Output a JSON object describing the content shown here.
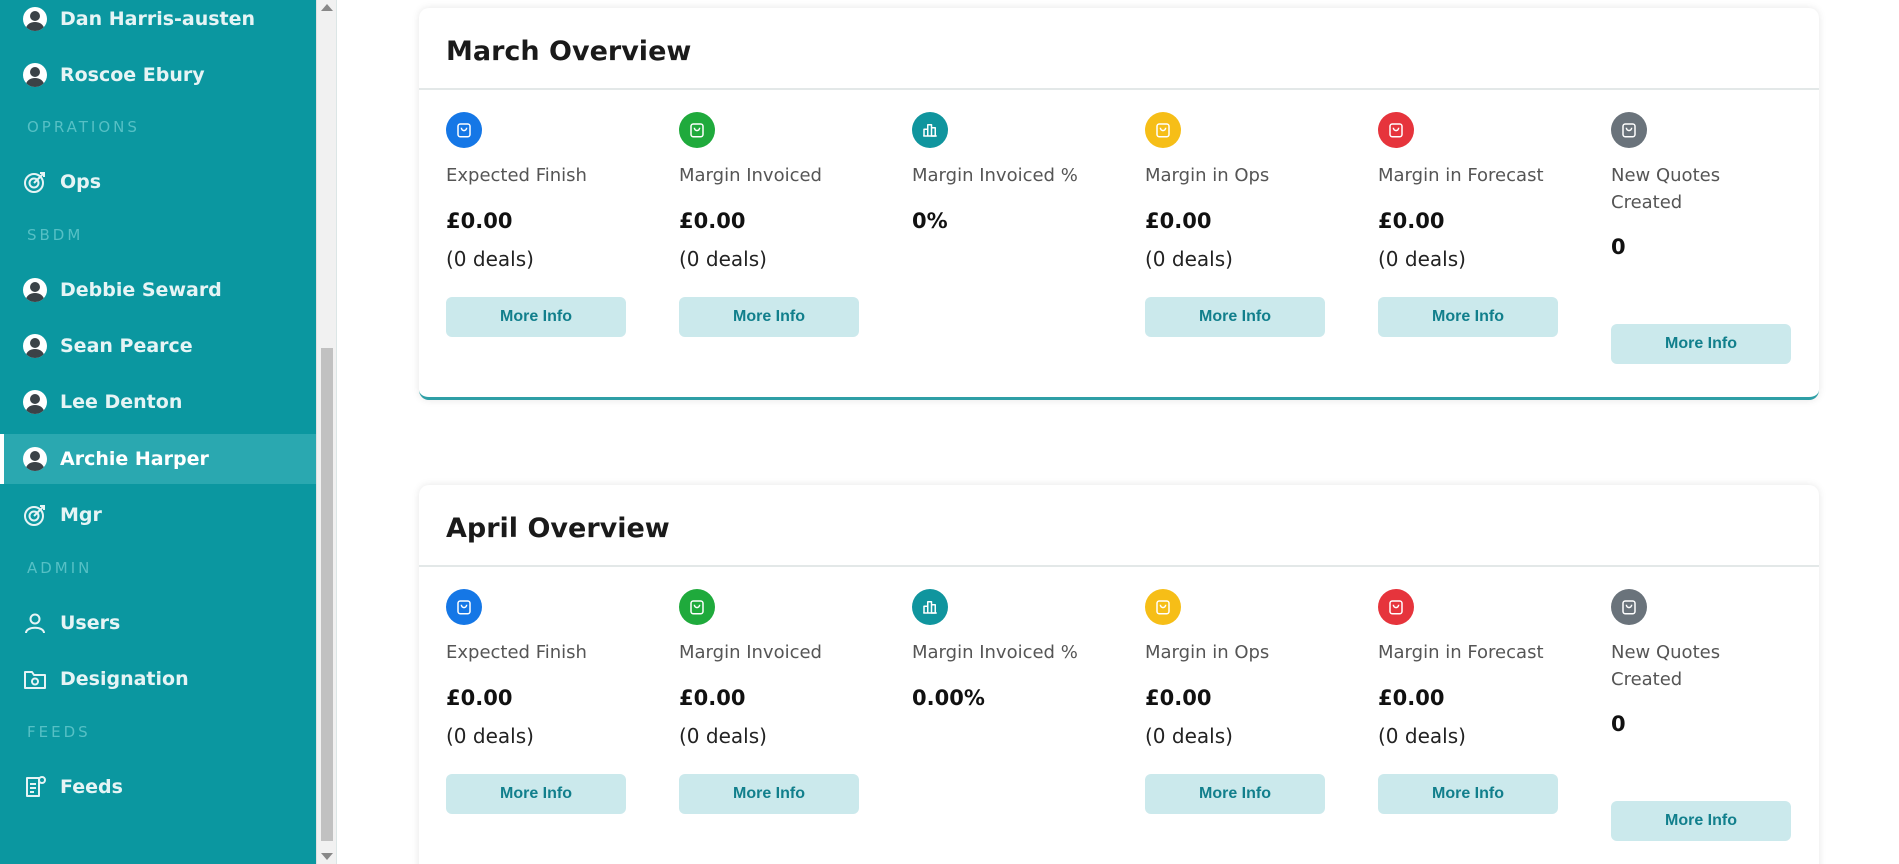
{
  "sidebar": {
    "items": [
      {
        "label": "Dan Harris-austen",
        "icon": "user-avatar-icon"
      },
      {
        "label": "Roscoe Ebury",
        "icon": "user-avatar-icon"
      },
      {
        "section": "OPRATIONS"
      },
      {
        "label": "Ops",
        "icon": "target-icon"
      },
      {
        "section": "SBDM"
      },
      {
        "label": "Debbie Seward",
        "icon": "user-avatar-icon"
      },
      {
        "label": "Sean Pearce",
        "icon": "user-avatar-icon"
      },
      {
        "label": "Lee Denton",
        "icon": "user-avatar-icon"
      },
      {
        "label": "Archie Harper",
        "icon": "user-avatar-icon",
        "active": true
      },
      {
        "label": "Mgr",
        "icon": "target-icon"
      },
      {
        "section": "ADMIN"
      },
      {
        "label": "Users",
        "icon": "user-outline-icon"
      },
      {
        "label": "Designation",
        "icon": "folder-icon"
      },
      {
        "section": "FEEDS"
      },
      {
        "label": "Feeds",
        "icon": "feed-icon"
      }
    ]
  },
  "colors": {
    "sidebar_bg": "#0b97a0",
    "active_item_bg": "#2aa8b0",
    "button_bg": "#cbe9ec",
    "button_text": "#117f8c",
    "blue": "#1577e6",
    "green": "#1faa3c",
    "teal": "#10959e",
    "yellow": "#f6be17",
    "red": "#e6343c",
    "gray": "#6a737b"
  },
  "cards": [
    {
      "title": "March Overview",
      "metrics": [
        {
          "label": "Expected Finish",
          "value": "£0.00",
          "deals": "(0 deals)",
          "button": "More Info",
          "color": "blue",
          "icon": "bag-icon"
        },
        {
          "label": "Margin Invoiced",
          "value": "£0.00",
          "deals": "(0 deals)",
          "button": "More Info",
          "color": "green",
          "icon": "bag-icon"
        },
        {
          "label": "Margin Invoiced %",
          "value": "0%",
          "deals": "",
          "button": "",
          "color": "teal",
          "icon": "bar-chart-icon"
        },
        {
          "label": "Margin in Ops",
          "value": "£0.00",
          "deals": "(0 deals)",
          "button": "More Info",
          "color": "yellow",
          "icon": "bag-icon"
        },
        {
          "label": "Margin in Forecast",
          "value": "£0.00",
          "deals": "(0 deals)",
          "button": "More Info",
          "color": "red",
          "icon": "bag-icon"
        },
        {
          "label": "New Quotes Created",
          "value": "0",
          "deals": "",
          "button": "More Info",
          "color": "gray",
          "icon": "bag-icon"
        }
      ]
    },
    {
      "title": "April Overview",
      "metrics": [
        {
          "label": "Expected Finish",
          "value": "£0.00",
          "deals": "(0 deals)",
          "button": "More Info",
          "color": "blue",
          "icon": "bag-icon"
        },
        {
          "label": "Margin Invoiced",
          "value": "£0.00",
          "deals": "(0 deals)",
          "button": "More Info",
          "color": "green",
          "icon": "bag-icon"
        },
        {
          "label": "Margin Invoiced %",
          "value": "0.00%",
          "deals": "",
          "button": "",
          "color": "teal",
          "icon": "bar-chart-icon"
        },
        {
          "label": "Margin in Ops",
          "value": "£0.00",
          "deals": "(0 deals)",
          "button": "More Info",
          "color": "yellow",
          "icon": "bag-icon"
        },
        {
          "label": "Margin in Forecast",
          "value": "£0.00",
          "deals": "(0 deals)",
          "button": "More Info",
          "color": "red",
          "icon": "bag-icon"
        },
        {
          "label": "New Quotes Created",
          "value": "0",
          "deals": "",
          "button": "More Info",
          "color": "gray",
          "icon": "bag-icon"
        }
      ]
    }
  ]
}
